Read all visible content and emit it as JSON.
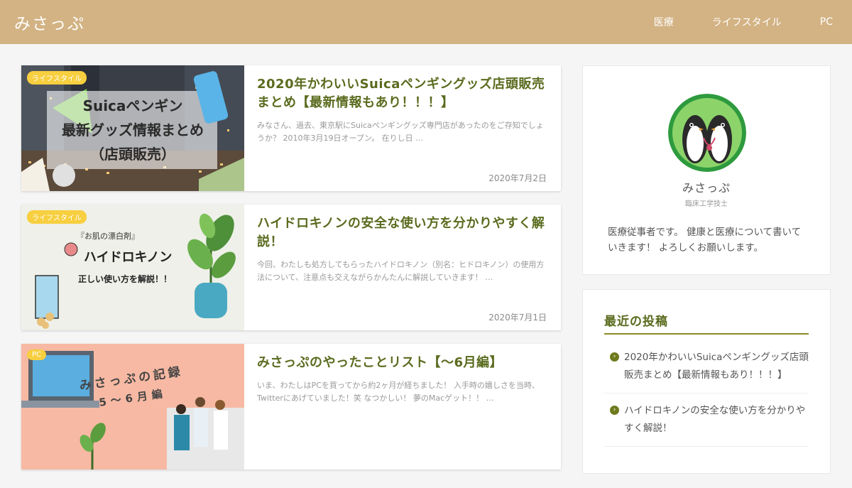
{
  "site": {
    "title": "みさっぷ",
    "nav": [
      "医療",
      "ライフスタイル",
      "PC"
    ]
  },
  "posts": [
    {
      "category": "ライフスタイル",
      "title": "2020年かわいいSuicaペンギングッズ店頭販売まとめ【最新情報もあり！！！】",
      "excerpt": "みなさん、過去、東京駅にSuicaペンギングッズ専門店があったのをご存知でしょうか？ 2010年3月19日オープン。 在りし日 …",
      "date": "2020年7月2日",
      "thumb_text": [
        "Suicaペンギン",
        "最新グッズ情報まとめ",
        "（店頭販売）"
      ]
    },
    {
      "category": "ライフスタイル",
      "title": "ハイドロキノンの安全な使い方を分かりやすく解説！",
      "excerpt": "今回、わたしも処方してもらったハイドロキノン（別名：ヒドロキノン）の使用方法について、注意点も交えながらかんたんに解説していきます！ …",
      "date": "2020年7月1日",
      "thumb_text": [
        "『お肌の漂白剤』",
        "ハイドロキノン",
        "正しい使い方を解説！！"
      ]
    },
    {
      "category": "PC",
      "title": "みさっぷのやったことリスト【〜6月編】",
      "excerpt": "いま、わたしはPCを買ってから約2ヶ月が経ちました！ 入手時の嬉しさを当時、Twitterにあげていました！笑 なつかしい！ 夢のMacゲット！！ …",
      "date": "",
      "thumb_text": [
        "みさっぷの記録",
        "5〜6月編"
      ]
    }
  ],
  "profile": {
    "name": "みさっぷ",
    "role": "臨床工学技士",
    "description": "医療従事者です。 健康と医療について書いていきます！ よろしくお願いします。"
  },
  "recent": {
    "heading": "最近の投稿",
    "items": [
      "2020年かわいいSuicaペンギングッズ店頭販売まとめ【最新情報もあり！！！】",
      "ハイドロキノンの安全な使い方を分かりやすく解説！"
    ]
  },
  "colors": {
    "header_bg": "#d3b384",
    "accent_green": "#5a6b1e",
    "badge_yellow": "#f7cf3f",
    "thumb3_bg": "#f7b9a3"
  }
}
